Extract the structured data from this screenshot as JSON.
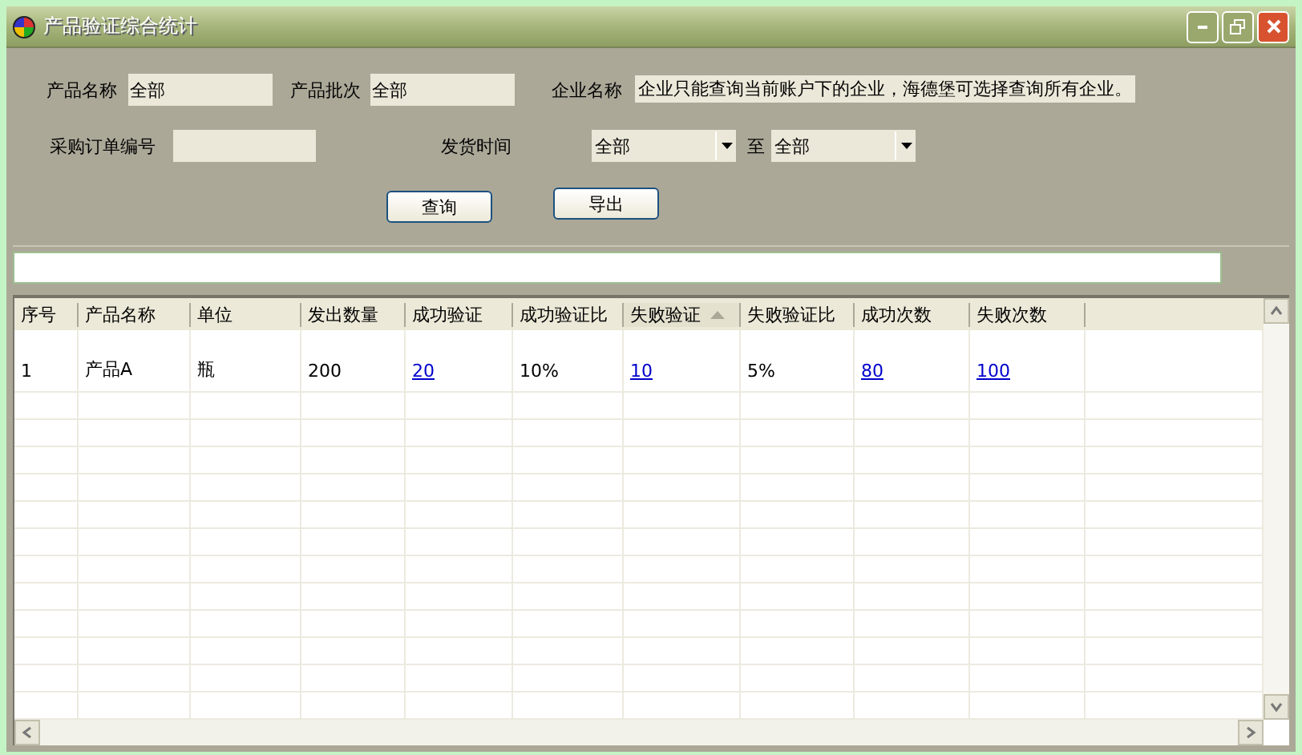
{
  "window": {
    "title": "产品验证综合统计"
  },
  "filters": {
    "product_name": {
      "label": "产品名称",
      "value": "全部"
    },
    "product_batch": {
      "label": "产品批次",
      "value": "全部"
    },
    "company_name": {
      "label": "企业名称",
      "value": "企业只能查询当前账户下的企业，海德堡可选择查询所有企业。"
    },
    "purchase_order": {
      "label": "采购订单编号"
    },
    "ship_time": {
      "label": "发货时间",
      "from": "全部",
      "separator": "至",
      "to": "全部"
    }
  },
  "buttons": [
    {
      "label": "查询"
    },
    {
      "label": "导出"
    }
  ],
  "table": {
    "columns": [
      {
        "label": "序号",
        "sorted": false
      },
      {
        "label": "产品名称",
        "sorted": false
      },
      {
        "label": "单位",
        "sorted": false
      },
      {
        "label": "发出数量",
        "sorted": false
      },
      {
        "label": "成功验证",
        "sorted": false
      },
      {
        "label": "成功验证比",
        "sorted": false
      },
      {
        "label": "失败验证",
        "sorted": true
      },
      {
        "label": "失败验证比",
        "sorted": false
      },
      {
        "label": "成功次数",
        "sorted": false
      },
      {
        "label": "失败次数",
        "sorted": false
      }
    ],
    "rows": [
      [
        {
          "kind": "text",
          "text": "1"
        },
        {
          "kind": "text",
          "text": "产品A"
        },
        {
          "kind": "text",
          "text": "瓶"
        },
        {
          "kind": "text",
          "text": "200"
        },
        {
          "kind": "link",
          "text": "20"
        },
        {
          "kind": "text",
          "text": "10%"
        },
        {
          "kind": "link",
          "text": "10"
        },
        {
          "kind": "text",
          "text": "5%"
        },
        {
          "kind": "link",
          "text": "80"
        },
        {
          "kind": "link",
          "text": "100"
        }
      ]
    ]
  }
}
